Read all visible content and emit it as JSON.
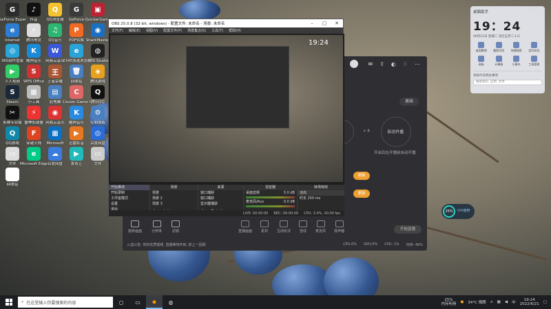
{
  "desktop": {
    "icons": [
      {
        "label": "GeForce Experience",
        "glyph": "G",
        "color": "#2c2c2c"
      },
      {
        "label": "抖音",
        "glyph": "♪",
        "color": "#111"
      },
      {
        "label": "QQ浏览器",
        "glyph": "Q",
        "color": "#f3c231"
      },
      {
        "label": "GeForce",
        "glyph": "G",
        "color": "#3a3a3a"
      },
      {
        "label": "QuickerGame",
        "glyph": "▣",
        "color": "#b23"
      },
      {
        "label": "Internet",
        "glyph": "e",
        "color": "#2d7dd2"
      },
      {
        "label": "腾讯电竞",
        "glyph": "⚡",
        "color": "#ddd"
      },
      {
        "label": "QQ音乐",
        "glyph": "♫",
        "color": "#2bb672"
      },
      {
        "label": "PDF转换",
        "glyph": "P",
        "color": "#f06a24"
      },
      {
        "label": "SharkMaster",
        "glyph": "◉",
        "color": "#1b6fc1"
      },
      {
        "label": "360软件管家",
        "glyph": "◎",
        "color": "#2aa3d8"
      },
      {
        "label": "酷狗音乐",
        "glyph": "K",
        "color": "#1a8bd8"
      },
      {
        "label": "网易云音乐",
        "glyph": "W",
        "color": "#3a58d9"
      },
      {
        "label": "2345加速浏览器",
        "glyph": "e",
        "color": "#2aa3d8"
      },
      {
        "label": "OBS Studio",
        "glyph": "◍",
        "color": "#222"
      },
      {
        "label": "人人视频",
        "glyph": "▶",
        "color": "#3c6"
      },
      {
        "label": "WPS Office",
        "glyph": "S",
        "color": "#c33"
      },
      {
        "label": "王者荣耀",
        "glyph": "王",
        "color": "#a53"
      },
      {
        "label": "回收站",
        "glyph": "🗑",
        "color": "#4a7fbf"
      },
      {
        "label": "腾讯游戏",
        "glyph": "◈",
        "color": "#e8a11e"
      },
      {
        "label": "Steam",
        "glyph": "S",
        "color": "#1b2838"
      },
      {
        "label": "小工具",
        "glyph": "▦",
        "color": "#bbb"
      },
      {
        "label": "此电脑",
        "glyph": "▤",
        "color": "#4a80c0"
      },
      {
        "label": "Cousin Game Global",
        "glyph": "C",
        "color": "#d66"
      },
      {
        "label": "腾讯QQ",
        "glyph": "Q",
        "color": "#111"
      },
      {
        "label": "剪映专业版",
        "glyph": "✂",
        "color": "#111"
      },
      {
        "label": "雷神加速器",
        "glyph": "⚡",
        "color": "#e33"
      },
      {
        "label": "网易云音乐",
        "glyph": "◉",
        "color": "#d33"
      },
      {
        "label": "酷狗音乐",
        "glyph": "K",
        "color": "#2a8adf"
      },
      {
        "label": "控制面板",
        "glyph": "⚙",
        "color": "#4a80c0"
      },
      {
        "label": "QQ游戏",
        "glyph": "Q",
        "color": "#18a"
      },
      {
        "label": "穿越火线",
        "glyph": "F",
        "color": "#d42"
      },
      {
        "label": "Microsoft",
        "glyph": "▦",
        "color": "#0a70c2"
      },
      {
        "label": "迅雷影音",
        "glyph": "▶",
        "color": "#e87722"
      },
      {
        "label": "百度网盘",
        "glyph": "◎",
        "color": "#2a6dd9"
      },
      {
        "label": "文件",
        "glyph": "▭",
        "color": "#ddd"
      },
      {
        "label": "Microsoft Edge",
        "glyph": "e",
        "color": "#0c8"
      },
      {
        "label": "百度网盘",
        "glyph": "☁",
        "color": "#3a7ddd"
      },
      {
        "label": "爱奇艺",
        "glyph": "▶",
        "color": "#2bb"
      },
      {
        "label": "文件",
        "glyph": "▭",
        "color": "#ccc"
      },
      {
        "label": "回收站",
        "glyph": "⚐",
        "color": "#fff"
      }
    ]
  },
  "obs": {
    "title": "OBS 25.0.8 (32-bit, windows) - 配置文件: 未命名 - 场景: 未命名",
    "menu": [
      "文件(F)",
      "编辑(E)",
      "视图(V)",
      "配置文件(P)",
      "场景集合(S)",
      "工具(T)",
      "帮助(H)"
    ],
    "scenes_header": "场景",
    "scenes": [
      "场景",
      "场景 2",
      "场景 3"
    ],
    "sources_header": "来源",
    "sources": [
      "窗口捕获",
      "窗口捕获",
      "显示器捕获"
    ],
    "mixer_header": "混音器",
    "mixer": [
      {
        "name": "桌面音频",
        "db": "0.0 dB"
      },
      {
        "name": "麦克风/Aux",
        "db": "0.0 dB"
      }
    ],
    "transition_header": "转场特效",
    "transition_type": "淡出",
    "duration_label": "时长",
    "duration_value": "250 ms",
    "controls": [
      "开始推流",
      "开始录制",
      "工作室模式",
      "设置",
      "退出"
    ],
    "status": [
      "LIVE: 00:00:00",
      "REC: 00:00:00",
      "CPU: 3.0%, 30.00 fps"
    ]
  },
  "stream_app": {
    "exit_label": "退出",
    "circle_a_label": "2",
    "circle_b_label": "自动开播",
    "circle_b_desc": "开启后在开播前自动开播",
    "plus_sep": "+ 8",
    "orange_btn_1": "更新",
    "orange_btn_2": "更新",
    "left_tools": [
      "旋转画面",
      "分辨率",
      "滤镜"
    ],
    "tools": [
      "直播画面",
      "素材",
      "互动玩法",
      "连线",
      "麦克风",
      "扬声器"
    ],
    "start_btn": "开始直播",
    "bottom": [
      "入选公告: 你的优质视频, 直播等待开启, 抓上一回顾",
      "CPU:0%",
      "GPU:0%",
      "CPU: 1%",
      "内存: 46%"
    ]
  },
  "widget": {
    "header": "桌面助手",
    "time": "19：24",
    "date": "06月21日  星期二  农历五月二十三",
    "grid": [
      "桌面整理",
      "截图识别",
      "快捷搜索",
      "定时关机",
      "画板",
      "计算器",
      "记事本",
      "工具管理"
    ],
    "memo": "添加今日待办事项",
    "search_placeholder": "搜索网页, 应用, 文件"
  },
  "cpu_widget": {
    "value": "25%",
    "label": "CPU使用"
  },
  "taskbar": {
    "search_placeholder": "在这里输入你要搜索的内容",
    "memory_value": "25%",
    "memory_label": "内存利用",
    "weather": "34°C 晴朗",
    "time": "19:24",
    "date": "2022/6/21"
  }
}
